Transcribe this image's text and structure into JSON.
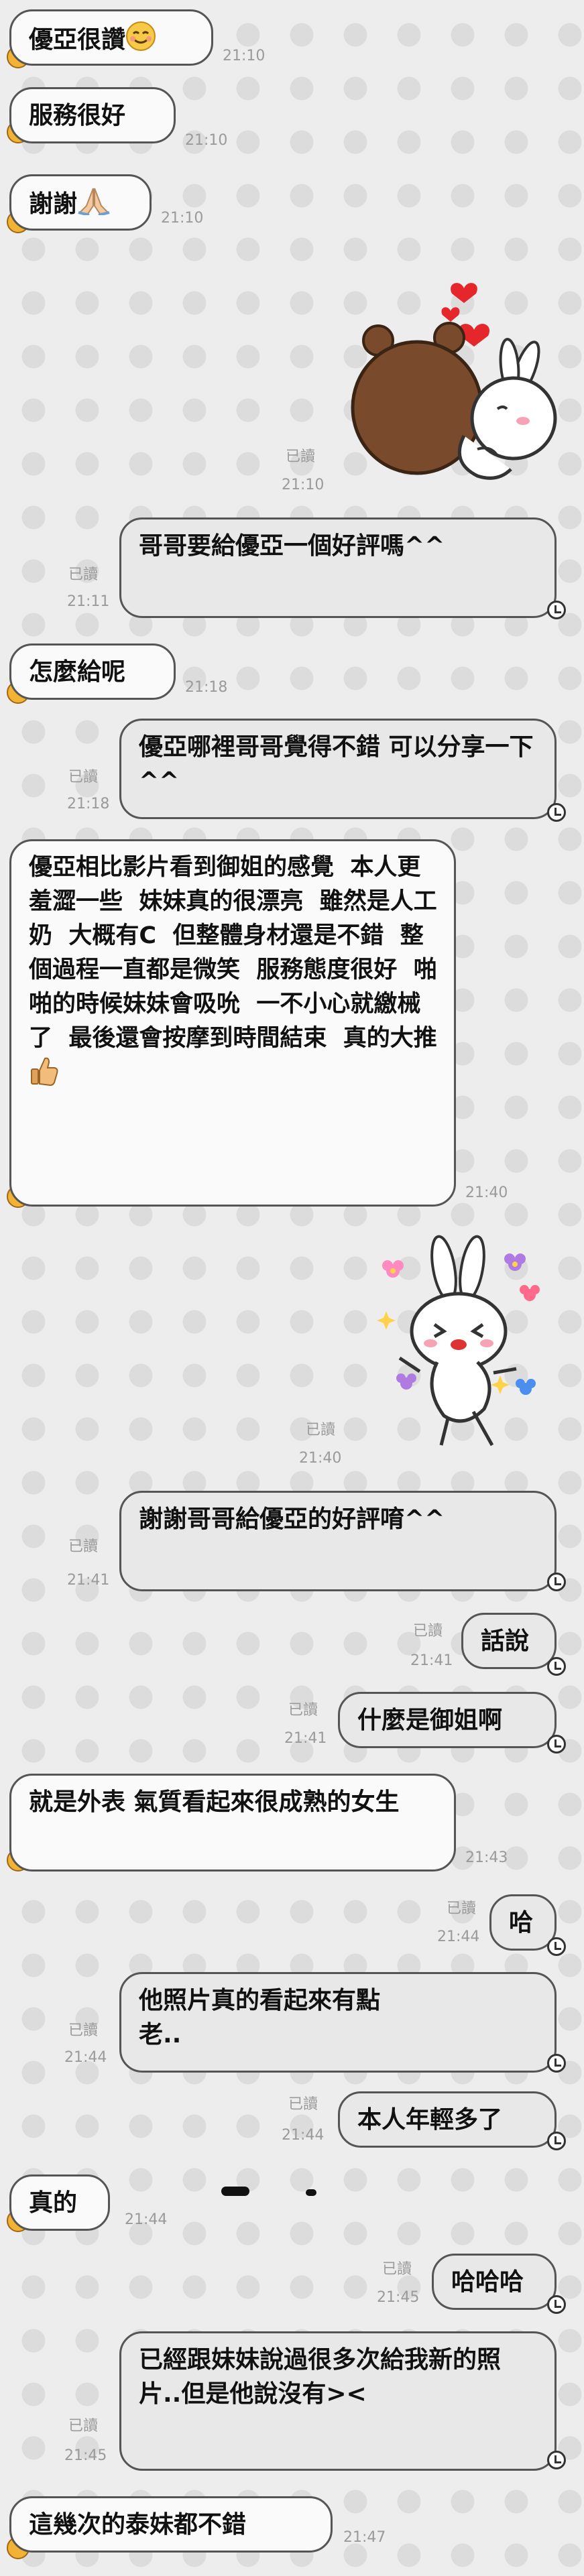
{
  "messages": [
    {
      "text": "優亞很讚",
      "time": "21:10"
    },
    {
      "text": "服務很好",
      "time": "21:10"
    },
    {
      "text": "謝謝",
      "time": "21:10"
    },
    {
      "read": "已讀",
      "time": "21:10"
    },
    {
      "text": "哥哥要給優亞一個好評嗎^^",
      "read": "已讀",
      "time": "21:11"
    },
    {
      "text": "怎麼給呢",
      "time": "21:18"
    },
    {
      "text": "優亞哪裡哥哥覺得不錯 可以分享一下^^",
      "read": "已讀",
      "time": "21:18"
    },
    {
      "text": "優亞相比影片看到御姐的感覺  本人更羞澀一些  妹妹真的很漂亮  雖然是人工奶  大概有C  但整體身材還是不錯  整個過程一直都是微笑  服務態度很好  啪啪的時候妹妹會吸吮  一不小心就繳械了  最後還會按摩到時間結束  真的大推",
      "time": "21:40"
    },
    {
      "read": "已讀",
      "time": "21:40"
    },
    {
      "text": "謝謝哥哥給優亞的好評唷^^",
      "read": "已讀",
      "time": "21:41"
    },
    {
      "text": "話說",
      "read": "已讀",
      "time": "21:41"
    },
    {
      "text": "什麼是御姐啊",
      "read": "已讀",
      "time": "21:41"
    },
    {
      "text": "就是外表 氣質看起來很成熟的女生",
      "time": "21:43"
    },
    {
      "text": "哈",
      "read": "已讀",
      "time": "21:44"
    },
    {
      "text": "他照片真的看起來有點老..",
      "read": "已讀",
      "time": "21:44"
    },
    {
      "text": "本人年輕多了",
      "read": "已讀",
      "time": "21:44"
    },
    {
      "text": "真的",
      "time": "21:44"
    },
    {
      "text": "哈哈哈",
      "read": "已讀",
      "time": "21:45"
    },
    {
      "text": "已經跟妹妹說過很多次給我新的照片..但是他說沒有><",
      "read": "已讀",
      "time": "21:45"
    },
    {
      "text": "這幾次的泰妹都不錯",
      "time": "21:47"
    }
  ],
  "icons": {
    "smile": "smiling-face-icon",
    "pray": "folded-hands-icon",
    "thumb": "thumbs-up-icon",
    "sticker1": "brown-cony-hug-sticker",
    "sticker2": "cony-dance-sticker"
  },
  "colors": {
    "background": "#ededed",
    "bubble_left": "#fafafa",
    "bubble_right": "#e8e8e8",
    "meta": "#9a9a9a"
  }
}
